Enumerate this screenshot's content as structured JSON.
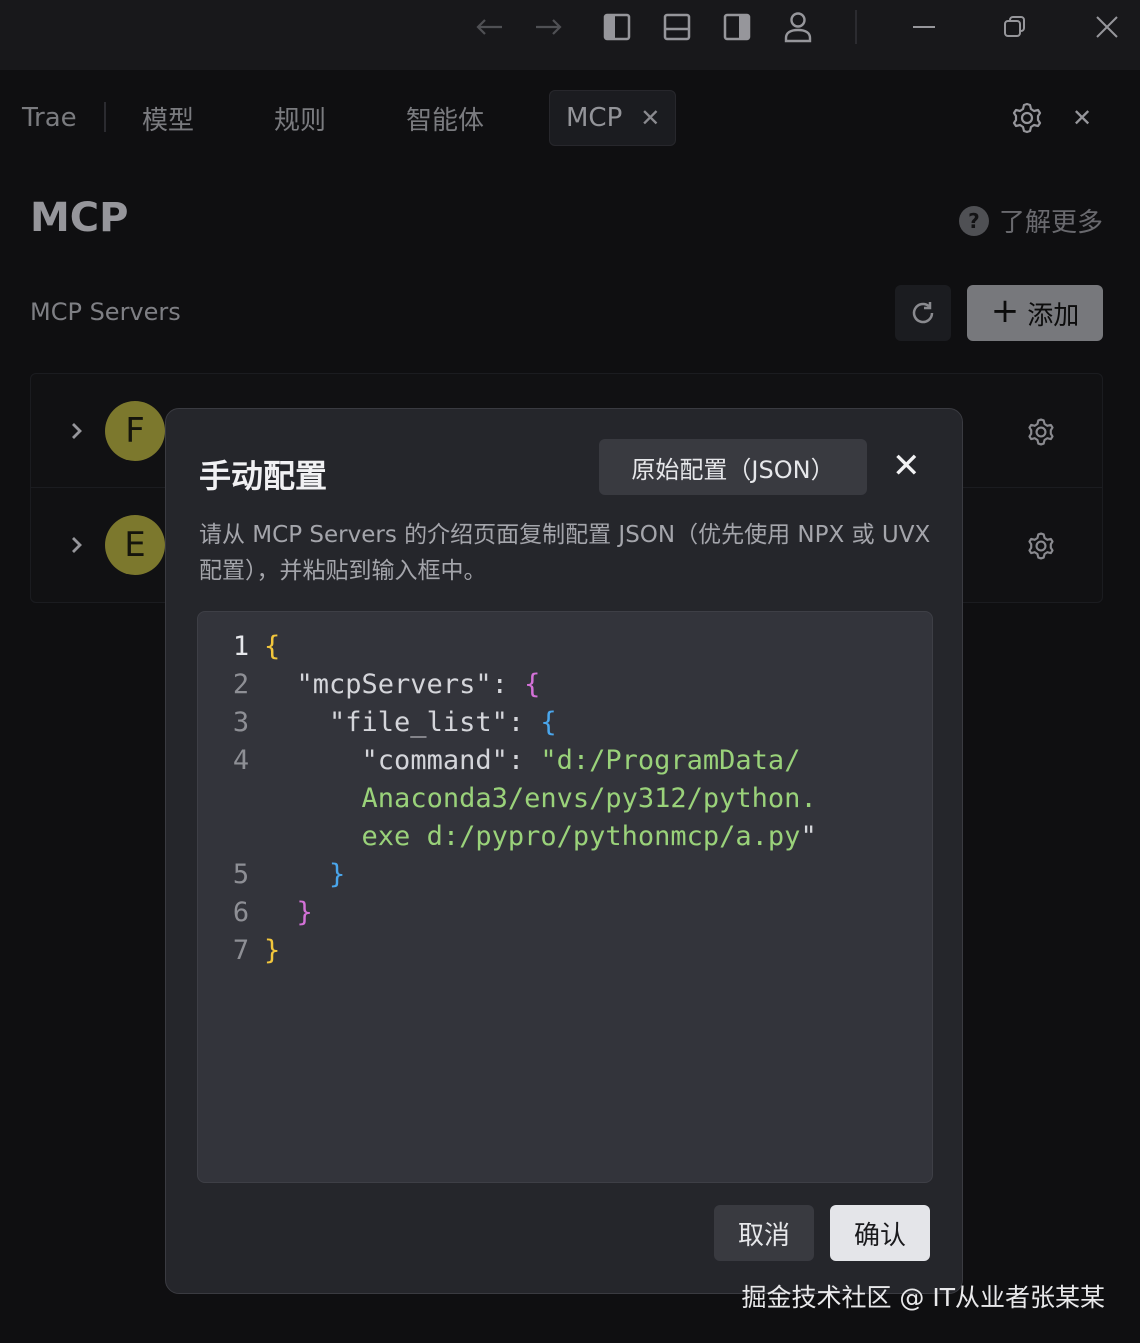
{
  "header": {
    "tabs": [
      "Trae",
      "模型",
      "规则",
      "智能体"
    ],
    "active_tab": "MCP",
    "active_tab_close": "✕",
    "close": "✕"
  },
  "page": {
    "title": "MCP",
    "learn_more": "了解更多",
    "help_glyph": "?",
    "servers_label": "MCP Servers",
    "add_label": "添加",
    "add_plus": "+",
    "servers": [
      {
        "initial": "F"
      },
      {
        "initial": "E"
      }
    ]
  },
  "modal": {
    "title": "手动配置",
    "json_button": "原始配置（JSON）",
    "close": "✕",
    "description": "请从 MCP Servers 的介绍页面复制配置 JSON（优先使用 NPX 或 UVX 配置），并粘贴到输入框中。",
    "line_numbers": [
      "1",
      "2",
      "3",
      "4",
      "",
      "",
      "5",
      "6",
      "7"
    ],
    "code": {
      "l1": "{",
      "l2_key": "\"mcpServers\": ",
      "l2_brace": "{",
      "l3_key": "\"file_list\": ",
      "l3_brace": "{",
      "l4_key": "\"command\": ",
      "l4_val_a": "\"d:/ProgramData/",
      "l4_val_b": "Anaconda3/envs/py312/python.",
      "l4_val_c": "exe d:/pypro/pythonmcp/a.py",
      "l4_val_quote": "\"",
      "l5": "}",
      "l6": "}",
      "l7": "}"
    },
    "cancel": "取消",
    "confirm": "确认"
  },
  "watermark": "掘金技术社区 @ IT从业者张某某",
  "colors": {
    "brace_yellow": "#f2c63c",
    "brace_purple": "#d471d8",
    "brace_blue": "#4aa6ec",
    "string_green": "#9ad27a",
    "avatar": "#a6a03c"
  }
}
